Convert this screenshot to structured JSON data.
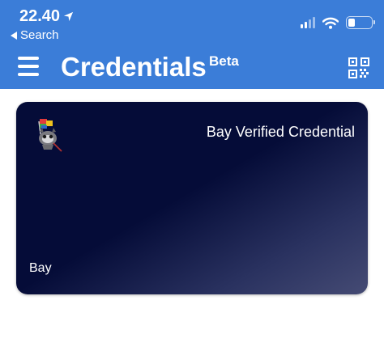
{
  "status_bar": {
    "time": "22.40",
    "back_label": "Search"
  },
  "header": {
    "title": "Credentials",
    "badge": "Beta",
    "menu_icon": "hamburger-menu-icon",
    "scan_icon": "qr-code-icon",
    "background_color": "#3b7dd8"
  },
  "credentials": [
    {
      "title": "Bay Verified Credential",
      "issuer": "Bay",
      "logo_icon": "issuer-mascot-icon",
      "card_color": "#050c38"
    }
  ]
}
